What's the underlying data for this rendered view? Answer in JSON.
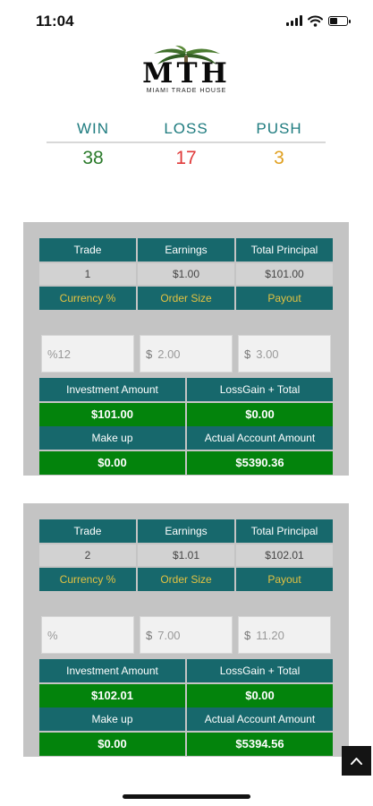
{
  "status": {
    "time": "11:04"
  },
  "brand": {
    "logo_letters": "MTH",
    "tagline": "MIAMI TRADE HOUSE"
  },
  "stats": {
    "win": {
      "label": "WIN",
      "value": "38",
      "color": "#2a7a2a"
    },
    "loss": {
      "label": "LOSS",
      "value": "17",
      "color": "#e03a3a"
    },
    "push": {
      "label": "PUSH",
      "value": "3",
      "color": "#e0a020"
    }
  },
  "labels": {
    "trade": "Trade",
    "earnings": "Earnings",
    "total_principal": "Total Principal",
    "currency_pct": "Currency %",
    "order_size": "Order Size",
    "payout": "Payout",
    "investment_amount": "Investment Amount",
    "lossgain_total": "LossGain + Total",
    "make_up": "Make up",
    "actual_account_amount": "Actual Account Amount"
  },
  "cards": [
    {
      "trade": "1",
      "earnings": "$1.00",
      "total_principal": "$101.00",
      "currency_pct": "%12",
      "currency_symbol": "$",
      "order_size": "2.00",
      "payout": "3.00",
      "investment_amount": "$101.00",
      "lossgain_total": "$0.00",
      "make_up": "$0.00",
      "actual_account_amount": "$5390.36"
    },
    {
      "trade": "2",
      "earnings": "$1.01",
      "total_principal": "$102.01",
      "currency_pct": "%",
      "currency_symbol": "$",
      "order_size": "7.00",
      "payout": "11.20",
      "investment_amount": "$102.01",
      "lossgain_total": "$0.00",
      "make_up": "$0.00",
      "actual_account_amount": "$5394.56"
    }
  ],
  "icons": {
    "signal": "cellular-signal-icon",
    "wifi": "wifi-icon",
    "battery": "battery-icon",
    "scroll_top": "chevron-up-icon"
  }
}
